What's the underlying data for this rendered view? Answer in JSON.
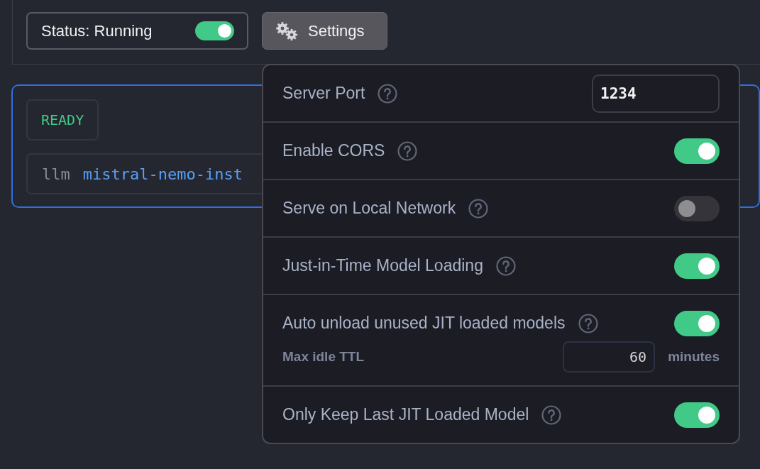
{
  "status": {
    "label": "Status: Running",
    "on": true
  },
  "settings_button": {
    "label": "Settings"
  },
  "model_card": {
    "badge": "READY",
    "command": "llm",
    "model": "mistral-nemo-inst"
  },
  "settings_menu": [
    {
      "kind": "number",
      "label": "Server Port",
      "value": "1234"
    },
    {
      "kind": "toggle",
      "label": "Enable CORS",
      "on": true
    },
    {
      "kind": "toggle",
      "label": "Serve on Local Network",
      "on": false
    },
    {
      "kind": "toggle",
      "label": "Just-in-Time Model Loading",
      "on": true
    },
    {
      "kind": "toggle",
      "label": "Auto unload unused JIT loaded models",
      "on": true,
      "sub": {
        "label": "Max idle TTL",
        "value": "60",
        "unit": "minutes"
      }
    },
    {
      "kind": "toggle",
      "label": "Only Keep Last JIT Loaded Model",
      "on": true
    }
  ]
}
